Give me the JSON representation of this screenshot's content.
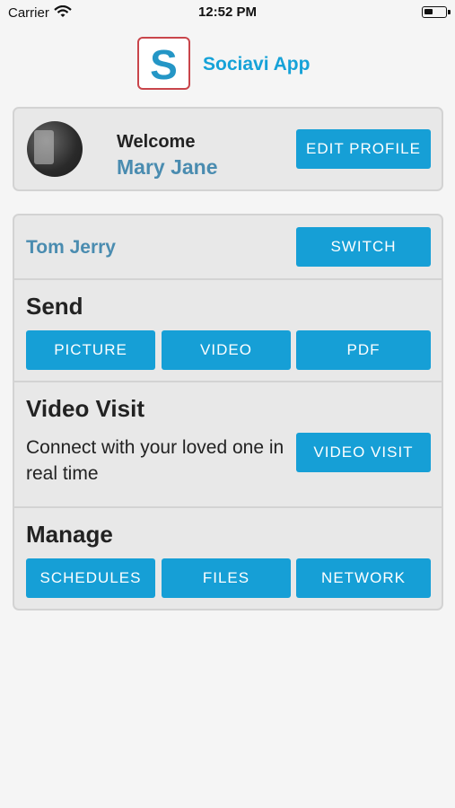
{
  "status_bar": {
    "carrier": "Carrier",
    "time": "12:52 PM"
  },
  "header": {
    "logo_letter": "S",
    "app_title": "Sociavi App"
  },
  "welcome": {
    "label": "Welcome",
    "name": "Mary Jane",
    "edit_profile_label": "EDIT PROFILE"
  },
  "user": {
    "name": "Tom Jerry",
    "switch_label": "SWITCH"
  },
  "send": {
    "title": "Send",
    "buttons": [
      "PICTURE",
      "VIDEO",
      "PDF"
    ]
  },
  "video_visit": {
    "title": "Video Visit",
    "description": "Connect with your loved one in real time",
    "button_label": "VIDEO VISIT"
  },
  "manage": {
    "title": "Manage",
    "buttons": [
      "SCHEDULES",
      "FILES",
      "NETWORK"
    ]
  },
  "colors": {
    "accent": "#169fd6",
    "name_blue": "#4a8cb0",
    "logo_border": "#c9454b",
    "background": "#f5f5f5",
    "card": "#e8e8e8"
  }
}
